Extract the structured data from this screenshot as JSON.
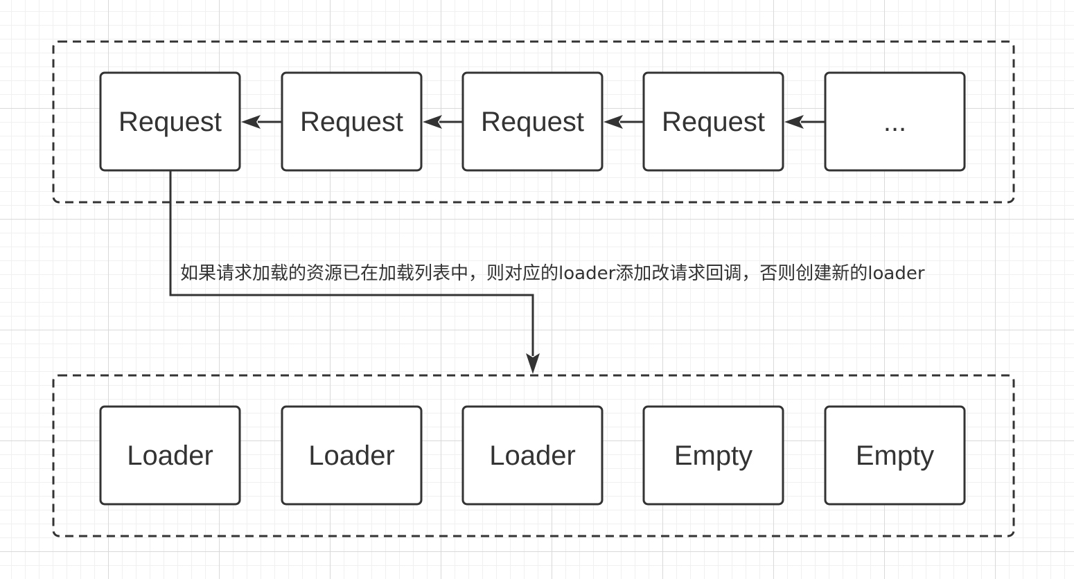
{
  "colors": {
    "stroke": "#333333",
    "text": "#333333",
    "node_fill": "#ffffff",
    "grid_major": "#d9d9d9",
    "grid_minor": "#f0f0f0"
  },
  "request_queue": {
    "nodes": [
      {
        "label": "Request"
      },
      {
        "label": "Request"
      },
      {
        "label": "Request"
      },
      {
        "label": "Request"
      },
      {
        "label": "..."
      }
    ]
  },
  "loader_pool": {
    "nodes": [
      {
        "label": "Loader"
      },
      {
        "label": "Loader"
      },
      {
        "label": "Loader"
      },
      {
        "label": "Empty"
      },
      {
        "label": "Empty"
      }
    ]
  },
  "connector": {
    "label": "如果请求加载的资源已在加载列表中，则对应的loader添加改请求回调，否则创建新的loader"
  }
}
